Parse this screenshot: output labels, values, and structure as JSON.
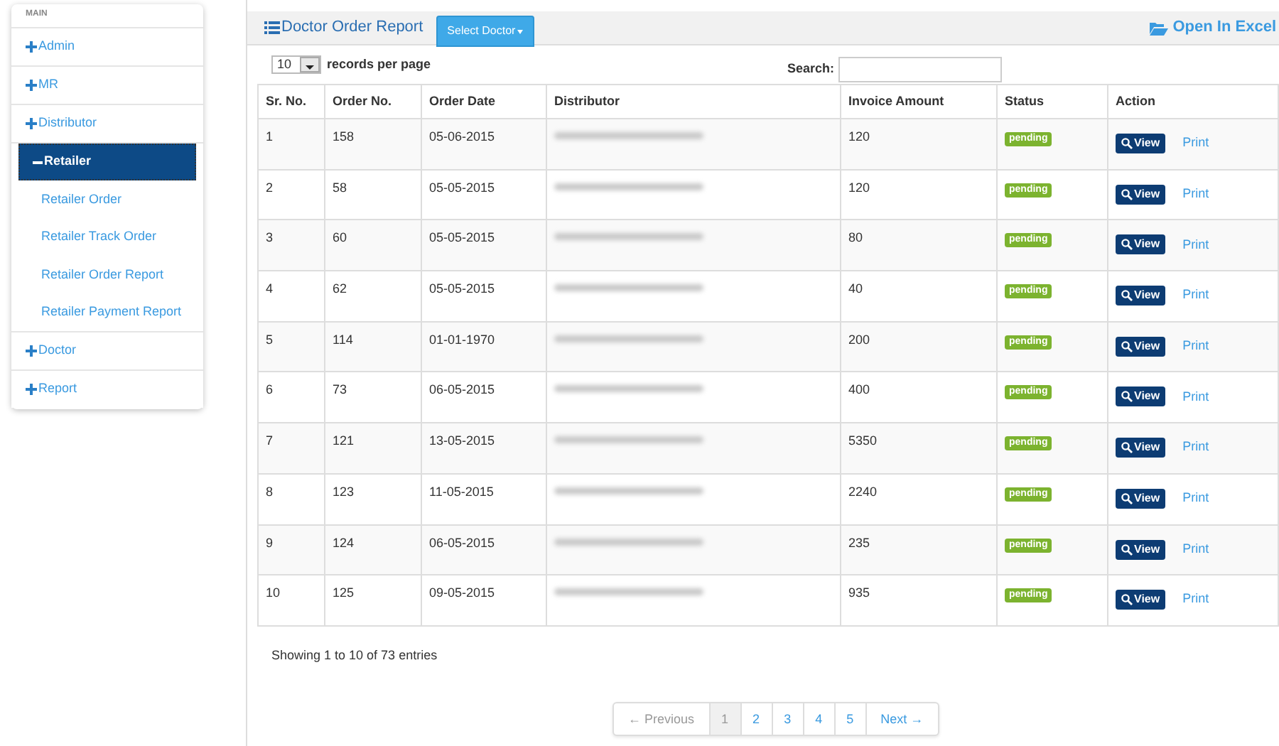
{
  "sidebar": {
    "heading": "MAIN",
    "items": [
      {
        "label": "Admin",
        "expanded": false
      },
      {
        "label": "MR",
        "expanded": false
      },
      {
        "label": "Distributor",
        "expanded": false
      },
      {
        "label": "Retailer",
        "expanded": true,
        "selected": true,
        "children": [
          {
            "label": "Retailer Order"
          },
          {
            "label": "Retailer Track Order"
          },
          {
            "label": "Retailer Order Report"
          },
          {
            "label": "Retailer Payment Report"
          }
        ]
      },
      {
        "label": "Doctor",
        "expanded": false
      },
      {
        "label": "Report",
        "expanded": false
      }
    ]
  },
  "panel": {
    "title": "Doctor Order Report",
    "select_button": "Select Doctor",
    "excel_link": "Open In Excel"
  },
  "page_size": {
    "value": "10",
    "label": "records per page"
  },
  "search": {
    "label": "Search:"
  },
  "table": {
    "columns": [
      "Sr. No.",
      "Order No.",
      "Order Date",
      "Distributor",
      "Invoice Amount",
      "Status",
      "Action"
    ],
    "rows": [
      {
        "sr": "1",
        "order": "158",
        "date": "05-06-2015",
        "amount": "120",
        "status": "pending",
        "view": "View",
        "print": "Print"
      },
      {
        "sr": "2",
        "order": "58",
        "date": "05-05-2015",
        "amount": "120",
        "status": "pending",
        "view": "View",
        "print": "Print"
      },
      {
        "sr": "3",
        "order": "60",
        "date": "05-05-2015",
        "amount": "80",
        "status": "pending",
        "view": "View",
        "print": "Print"
      },
      {
        "sr": "4",
        "order": "62",
        "date": "05-05-2015",
        "amount": "40",
        "status": "pending",
        "view": "View",
        "print": "Print"
      },
      {
        "sr": "5",
        "order": "114",
        "date": "01-01-1970",
        "amount": "200",
        "status": "pending",
        "view": "View",
        "print": "Print"
      },
      {
        "sr": "6",
        "order": "73",
        "date": "06-05-2015",
        "amount": "400",
        "status": "pending",
        "view": "View",
        "print": "Print"
      },
      {
        "sr": "7",
        "order": "121",
        "date": "13-05-2015",
        "amount": "5350",
        "status": "pending",
        "view": "View",
        "print": "Print"
      },
      {
        "sr": "8",
        "order": "123",
        "date": "11-05-2015",
        "amount": "2240",
        "status": "pending",
        "view": "View",
        "print": "Print"
      },
      {
        "sr": "9",
        "order": "124",
        "date": "06-05-2015",
        "amount": "235",
        "status": "pending",
        "view": "View",
        "print": "Print"
      },
      {
        "sr": "10",
        "order": "125",
        "date": "09-05-2015",
        "amount": "935",
        "status": "pending",
        "view": "View",
        "print": "Print"
      }
    ]
  },
  "info": "Showing 1 to 10 of 73 entries",
  "pagination": [
    {
      "label": "← Previous",
      "kind": "prev",
      "disabled": true,
      "selected": false
    },
    {
      "label": "1",
      "kind": "page",
      "selected": true
    },
    {
      "label": "2",
      "kind": "page",
      "selected": false
    },
    {
      "label": "3",
      "kind": "page",
      "selected": false
    },
    {
      "label": "4",
      "kind": "page",
      "selected": false
    },
    {
      "label": "5",
      "kind": "page",
      "selected": false
    },
    {
      "label": "Next →",
      "kind": "next",
      "disabled": false,
      "selected": false
    }
  ]
}
